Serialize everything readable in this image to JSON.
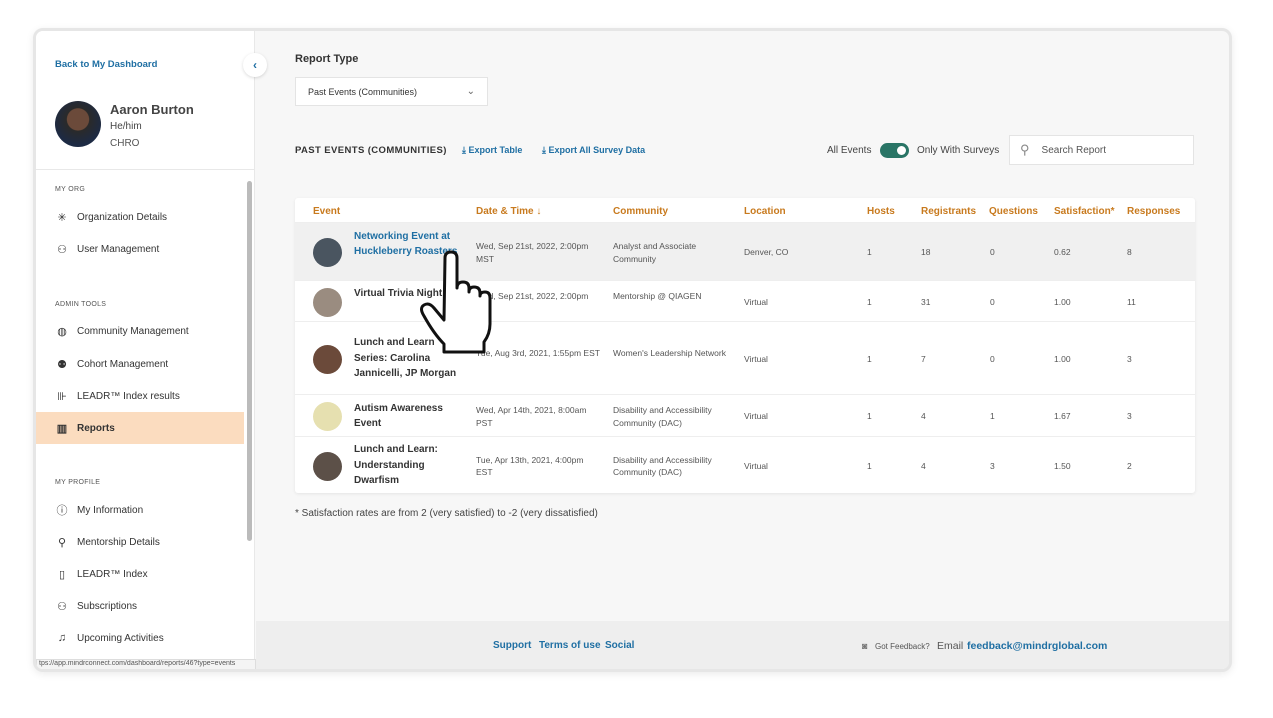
{
  "sidebar": {
    "back_link": "Back to My Dashboard",
    "user": {
      "name": "Aaron Burton",
      "pronouns": "He/him",
      "title": "CHRO"
    },
    "sections": [
      {
        "label": "MY ORG",
        "items": [
          {
            "label": "Organization Details",
            "icon": "sparkle-icon"
          },
          {
            "label": "User Management",
            "icon": "user-settings-icon"
          }
        ]
      },
      {
        "label": "ADMIN TOOLS",
        "items": [
          {
            "label": "Community Management",
            "icon": "globe-icon"
          },
          {
            "label": "Cohort Management",
            "icon": "group-icon"
          },
          {
            "label": "LEADR™ Index results",
            "icon": "chart-person-icon"
          },
          {
            "label": "Reports",
            "icon": "bar-chart-icon",
            "active": true
          }
        ]
      },
      {
        "label": "MY PROFILE",
        "items": [
          {
            "label": "My Information",
            "icon": "info-icon"
          },
          {
            "label": "Mentorship Details",
            "icon": "mentor-icon"
          },
          {
            "label": "LEADR™ Index",
            "icon": "index-icon"
          },
          {
            "label": "Subscriptions",
            "icon": "user-check-icon"
          },
          {
            "label": "Upcoming Activities",
            "icon": "bell-icon"
          }
        ]
      }
    ],
    "status_url": "tps://app.mindrconnect.com/dashboard/reports/46?type=events"
  },
  "main": {
    "report_type_label": "Report Type",
    "report_type_value": "Past Events (Communities)",
    "section_title": "PAST EVENTS (COMMUNITIES)",
    "export_table": "Export Table",
    "export_all": "Export All Survey Data",
    "toggle_left": "All Events",
    "toggle_right": "Only With Surveys",
    "toggle_on": true,
    "search_placeholder": "Search Report",
    "columns": [
      "Event",
      "Date & Time ↓",
      "Community",
      "Location",
      "Hosts",
      "Registrants",
      "Questions",
      "Satisfaction*",
      "Responses"
    ],
    "rows": [
      {
        "event": "Networking Event at Huckleberry Roasters",
        "date": "Wed, Sep 21st, 2022, 2:00pm MST",
        "community": "Analyst and Associate Community",
        "location": "Denver, CO",
        "hosts": "1",
        "registrants": "18",
        "questions": "0",
        "satisfaction": "0.62",
        "responses": "8"
      },
      {
        "event": "Virtual Trivia Night",
        "date": "Wed, Sep 21st, 2022, 2:00pm",
        "community": "Mentorship @ QIAGEN",
        "location": "Virtual",
        "hosts": "1",
        "registrants": "31",
        "questions": "0",
        "satisfaction": "1.00",
        "responses": "11"
      },
      {
        "event": "Lunch and Learn Series: Carolina Jannicelli, JP Morgan",
        "date": "Tue, Aug 3rd, 2021, 1:55pm EST",
        "community": "Women's Leadership Network",
        "location": "Virtual",
        "hosts": "1",
        "registrants": "7",
        "questions": "0",
        "satisfaction": "1.00",
        "responses": "3"
      },
      {
        "event": "Autism Awareness Event",
        "date": "Wed, Apr 14th, 2021, 8:00am PST",
        "community": "Disability and Accessibility Community (DAC)",
        "location": "Virtual",
        "hosts": "1",
        "registrants": "4",
        "questions": "1",
        "satisfaction": "1.67",
        "responses": "3"
      },
      {
        "event": "Lunch and Learn: Understanding Dwarfism",
        "date": "Tue, Apr 13th, 2021, 4:00pm EST",
        "community": "Disability and Accessibility Community (DAC)",
        "location": "Virtual",
        "hosts": "1",
        "registrants": "4",
        "questions": "3",
        "satisfaction": "1.50",
        "responses": "2"
      }
    ],
    "footnote": "* Satisfaction rates are from 2 (very satisfied) to -2 (very dissatisfied)"
  },
  "footer": {
    "links": [
      "Support",
      "Terms of use",
      "Social"
    ],
    "feedback": "Got Feedback?",
    "email_label": "Email",
    "email": "feedback@mindrglobal.com"
  },
  "colors": {
    "accent": "#1f6fa3",
    "header": "#c87a1e",
    "toggle": "#2a7566",
    "active_nav": "#fbdcbf"
  }
}
